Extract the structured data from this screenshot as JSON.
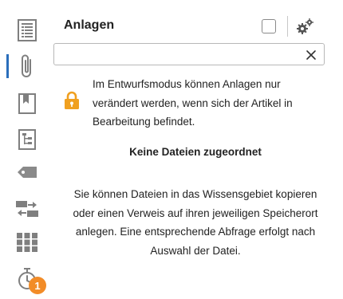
{
  "panel": {
    "title": "Anlagen",
    "settings_icon": "gears-icon"
  },
  "search": {
    "value": "",
    "placeholder": "",
    "clear_label": "×"
  },
  "info": {
    "icon": "lock-icon",
    "text": "Im Entwurfsmodus können Anlagen nur verändert werden, wenn sich der Artikel in Bearbeitung befindet."
  },
  "empty": {
    "title": "Keine Dateien zugeordnet",
    "description": "Sie können Dateien in das Wissensgebiet kopieren oder einen Verweis auf ihren jeweiligen Speicherort anlegen. Eine entsprechende Abfrage erfolgt nach Auswahl der Datei."
  },
  "rail": {
    "items": [
      {
        "icon": "document-list-icon"
      },
      {
        "icon": "paperclip-icon",
        "active": true
      },
      {
        "icon": "bookmark-icon"
      },
      {
        "icon": "tree-structure-icon"
      },
      {
        "icon": "tag-icon"
      },
      {
        "icon": "transfer-icon"
      },
      {
        "icon": "grid-icon"
      },
      {
        "icon": "timer-icon",
        "badge": "1"
      }
    ]
  },
  "colors": {
    "accent": "#2a6ebb",
    "icon_gray": "#7f7f7f",
    "lock": "#f0a020",
    "badge": "#f28c28"
  }
}
